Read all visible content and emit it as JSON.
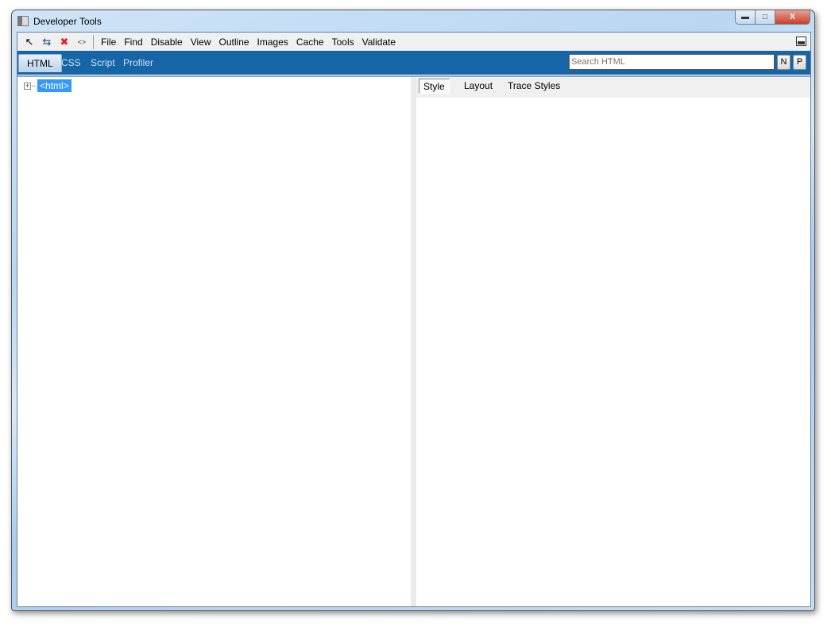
{
  "window": {
    "title": "Developer Tools"
  },
  "toolbar": {
    "icons": [
      "select-element-icon",
      "refresh-icon",
      "clear-browser-icon",
      "view-source-icon"
    ]
  },
  "menu": [
    "File",
    "Find",
    "Disable",
    "View",
    "Outline",
    "Images",
    "Cache",
    "Tools",
    "Validate"
  ],
  "tabs": [
    {
      "label": "HTML",
      "active": true
    },
    {
      "label": "CSS"
    },
    {
      "label": "Script"
    },
    {
      "label": "Profiler"
    }
  ],
  "search": {
    "placeholder": "Search HTML",
    "next": "N",
    "prev": "P"
  },
  "tree": {
    "root": "<html>",
    "expander": "+"
  },
  "right_tabs": [
    {
      "label": "Style",
      "active": true
    },
    {
      "label": "Layout"
    },
    {
      "label": "Trace Styles"
    }
  ]
}
